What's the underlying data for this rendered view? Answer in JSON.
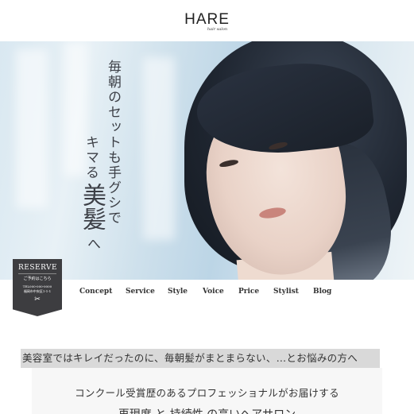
{
  "header": {
    "logo": "HARE",
    "logo_sub": "hair salon"
  },
  "hero": {
    "catch_line1": "毎朝のセットも手グシで",
    "catch_line2": "キマる",
    "catch_big": "美髪",
    "catch_end": "へ"
  },
  "reserve": {
    "title": "RESERVE",
    "sub": "ご予約はこちら",
    "tel": "TEL000-000-0000",
    "address": "福岡市中央区1-1-1",
    "icon": "scissors-icon"
  },
  "nav": {
    "items": [
      "Concept",
      "Service",
      "Style",
      "Voice",
      "Price",
      "Stylist",
      "Blog"
    ]
  },
  "intro": {
    "lead": "美容室ではキレイだったのに、毎朝髪がまとまらない、…とお悩みの方へ",
    "line2": "コンクール受賞歴のあるプロフェッショナルがお届けする",
    "line3": "再現度 と 持続性 の高いヘアサロン"
  }
}
